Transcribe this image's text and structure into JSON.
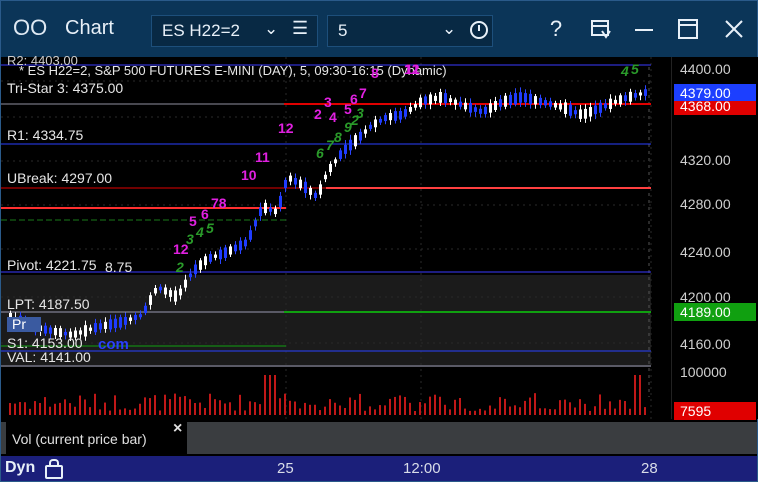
{
  "window": {
    "logo_icon": "OO",
    "title": "Chart",
    "symbol": "ES H22=2",
    "timeframe": "5",
    "help": "?",
    "buttons": [
      "list-icon",
      "clock-icon",
      "help-icon",
      "template-icon",
      "minimize-icon",
      "maximize-icon",
      "close-icon"
    ]
  },
  "chart": {
    "header": "* ES H22=2, S&P 500 FUTURES E-MINI (DAY), 5, 09:30-16:15 (Dynamic)",
    "header_prefix_clip": "R2: 4403.00",
    "levels": [
      {
        "label": "Tri-Star 3: 4375.00"
      },
      {
        "label": "R1: 4334.75"
      },
      {
        "label": "UBreak: 4297.00"
      },
      {
        "label": "Pivot: 4221.75"
      },
      {
        "label": "8.75"
      },
      {
        "label": "LPT: 4187.50"
      },
      {
        "label": "S1: 4153.00"
      },
      {
        "label": "VAL: 4141.00"
      }
    ],
    "overlays": {
      "pr": "Pr",
      "com": "com"
    },
    "markers": {
      "magenta": [
        "12",
        "11",
        "10",
        "78",
        "6",
        "5",
        "12",
        "2",
        "3",
        "4",
        "5",
        "6",
        "7",
        "8",
        "11",
        "12"
      ],
      "green": [
        "2",
        "3",
        "4",
        "5",
        "6",
        "7",
        "8",
        "9",
        "2",
        "3",
        "4",
        "5",
        "6",
        "7",
        "8",
        "9",
        "2",
        "5"
      ]
    }
  },
  "price_axis": {
    "ticks": [
      "4400.00",
      "4360.00",
      "4320.00",
      "4280.00",
      "4240.00",
      "4200.00",
      "4160.00"
    ],
    "last_price": "4379.00",
    "red_tag": "4368.00",
    "green_tag": "4189.00",
    "volume_ticks": [
      "100000"
    ],
    "volume_tag": "7595"
  },
  "volume_panel": {
    "label": "Vol (current price bar)",
    "close_icon": "×"
  },
  "time_axis": {
    "dyn_label": "Dyn",
    "labels": [
      "25",
      "12:00",
      "28"
    ]
  },
  "colors": {
    "title_bg": "#0b3558",
    "time_axis_bg": "#1b1f7a",
    "up_bar": "#ffffff",
    "down_bar": "#1f3cff",
    "magenta": "#e020e0",
    "green_marker": "#2a9a2a",
    "last_price_bg": "#1c3fff",
    "red_tag_bg": "#e00000",
    "green_tag_bg": "#10a010"
  }
}
